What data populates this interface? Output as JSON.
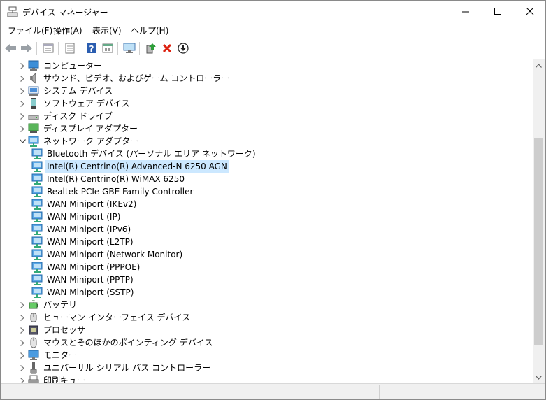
{
  "window": {
    "title": "デバイス マネージャー"
  },
  "menu": [
    {
      "label": "ファイル(F)"
    },
    {
      "label": "操作(A)"
    },
    {
      "label": "表示(V)"
    },
    {
      "label": "ヘルプ(H)"
    }
  ],
  "toolbar": {
    "buttons": [
      "back-icon",
      "forward-icon",
      "properties-view-icon",
      "list-view-icon",
      "help-icon",
      "sheet-icon",
      "monitor-icon",
      "update-driver-icon",
      "uninstall-icon",
      "download-icon"
    ]
  },
  "tree": [
    {
      "label": "コンピューター",
      "expander": "collapsed",
      "icon": "computer"
    },
    {
      "label": "サウンド、ビデオ、およびゲーム コントローラー",
      "expander": "collapsed",
      "icon": "sound"
    },
    {
      "label": "システム デバイス",
      "expander": "collapsed",
      "icon": "system"
    },
    {
      "label": "ソフトウェア デバイス",
      "expander": "collapsed",
      "icon": "software"
    },
    {
      "label": "ディスク ドライブ",
      "expander": "collapsed",
      "icon": "disk"
    },
    {
      "label": "ディスプレイ アダプター",
      "expander": "collapsed",
      "icon": "display"
    },
    {
      "label": "ネットワーク アダプター",
      "expander": "expanded",
      "icon": "network"
    },
    {
      "label": "Bluetooth デバイス (パーソナル エリア ネットワーク)",
      "child": true,
      "icon": "network"
    },
    {
      "label": "Intel(R) Centrino(R) Advanced-N 6250 AGN",
      "child": true,
      "icon": "network",
      "selected": true
    },
    {
      "label": "Intel(R) Centrino(R) WiMAX 6250",
      "child": true,
      "icon": "network"
    },
    {
      "label": "Realtek PCIe GBE Family Controller",
      "child": true,
      "icon": "network"
    },
    {
      "label": "WAN Miniport (IKEv2)",
      "child": true,
      "icon": "network"
    },
    {
      "label": "WAN Miniport (IP)",
      "child": true,
      "icon": "network"
    },
    {
      "label": "WAN Miniport (IPv6)",
      "child": true,
      "icon": "network"
    },
    {
      "label": "WAN Miniport (L2TP)",
      "child": true,
      "icon": "network"
    },
    {
      "label": "WAN Miniport (Network Monitor)",
      "child": true,
      "icon": "network"
    },
    {
      "label": "WAN Miniport (PPPOE)",
      "child": true,
      "icon": "network"
    },
    {
      "label": "WAN Miniport (PPTP)",
      "child": true,
      "icon": "network"
    },
    {
      "label": "WAN Miniport (SSTP)",
      "child": true,
      "icon": "network"
    },
    {
      "label": "バッテリ",
      "expander": "collapsed",
      "icon": "battery"
    },
    {
      "label": "ヒューマン インターフェイス デバイス",
      "expander": "collapsed",
      "icon": "hid"
    },
    {
      "label": "プロセッサ",
      "expander": "collapsed",
      "icon": "processor"
    },
    {
      "label": "マウスとそのほかのポインティング デバイス",
      "expander": "collapsed",
      "icon": "mouse"
    },
    {
      "label": "モニター",
      "expander": "collapsed",
      "icon": "monitor"
    },
    {
      "label": "ユニバーサル シリアル バス コントローラー",
      "expander": "collapsed",
      "icon": "usb"
    },
    {
      "label": "印刷キュー",
      "expander": "collapsed",
      "icon": "printer"
    }
  ]
}
